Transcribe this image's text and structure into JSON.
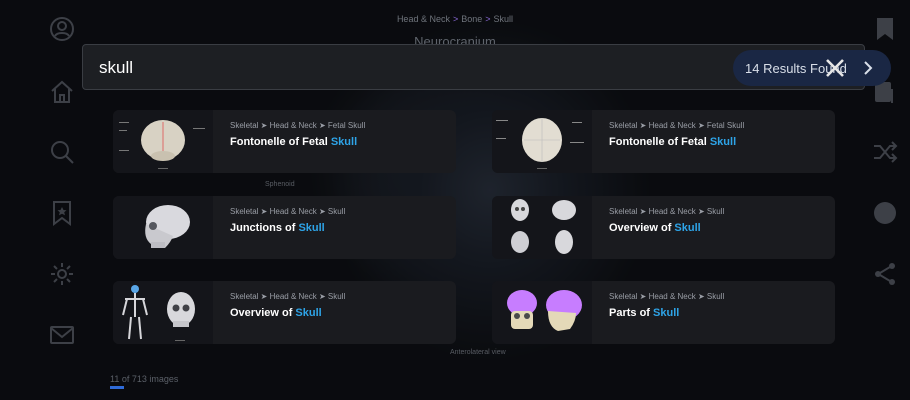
{
  "background": {
    "breadcrumb": [
      "Head & Neck",
      "Bone",
      "Skull"
    ],
    "breadcrumb_sep": ">",
    "title": "Neurocranium",
    "labels": [
      "Sphenoid",
      "Anterolateral view"
    ],
    "image_count": "11 of 713 images"
  },
  "search": {
    "query": "skull",
    "results_label": "14 Results Found"
  },
  "results": [
    {
      "path": "Skeletal ➤ Head & Neck ➤ Fetal Skull",
      "title_prefix": "Fontonelle of Fetal ",
      "highlight": "Skull"
    },
    {
      "path": "Skeletal ➤ Head & Neck ➤ Fetal Skull",
      "title_prefix": "Fontonelle of Fetal ",
      "highlight": "Skull"
    },
    {
      "path": "Skeletal ➤ Head & Neck ➤ Skull",
      "title_prefix": "Junctions of ",
      "highlight": "Skull"
    },
    {
      "path": "Skeletal ➤ Head & Neck ➤ Skull",
      "title_prefix": "Overview of ",
      "highlight": "Skull"
    },
    {
      "path": "Skeletal ➤ Head & Neck ➤ Skull",
      "title_prefix": "Overview of ",
      "highlight": "Skull"
    },
    {
      "path": "Skeletal ➤ Head & Neck ➤ Skull",
      "title_prefix": "Parts of ",
      "highlight": "Skull"
    }
  ],
  "left_rail_icons": [
    "user-icon",
    "home-icon",
    "search-icon",
    "bookmark-icon",
    "settings-icon",
    "mail-icon"
  ],
  "right_rail_icons": [
    "bookmark-icon",
    "quiz-icon",
    "shuffle-icon",
    "info-icon",
    "share-icon"
  ],
  "colors": {
    "accent_highlight": "#2ea4e8",
    "pill_bg": "#1a2744",
    "card_bg": "#1a1b1f",
    "purple_skull": "#c77dff"
  }
}
